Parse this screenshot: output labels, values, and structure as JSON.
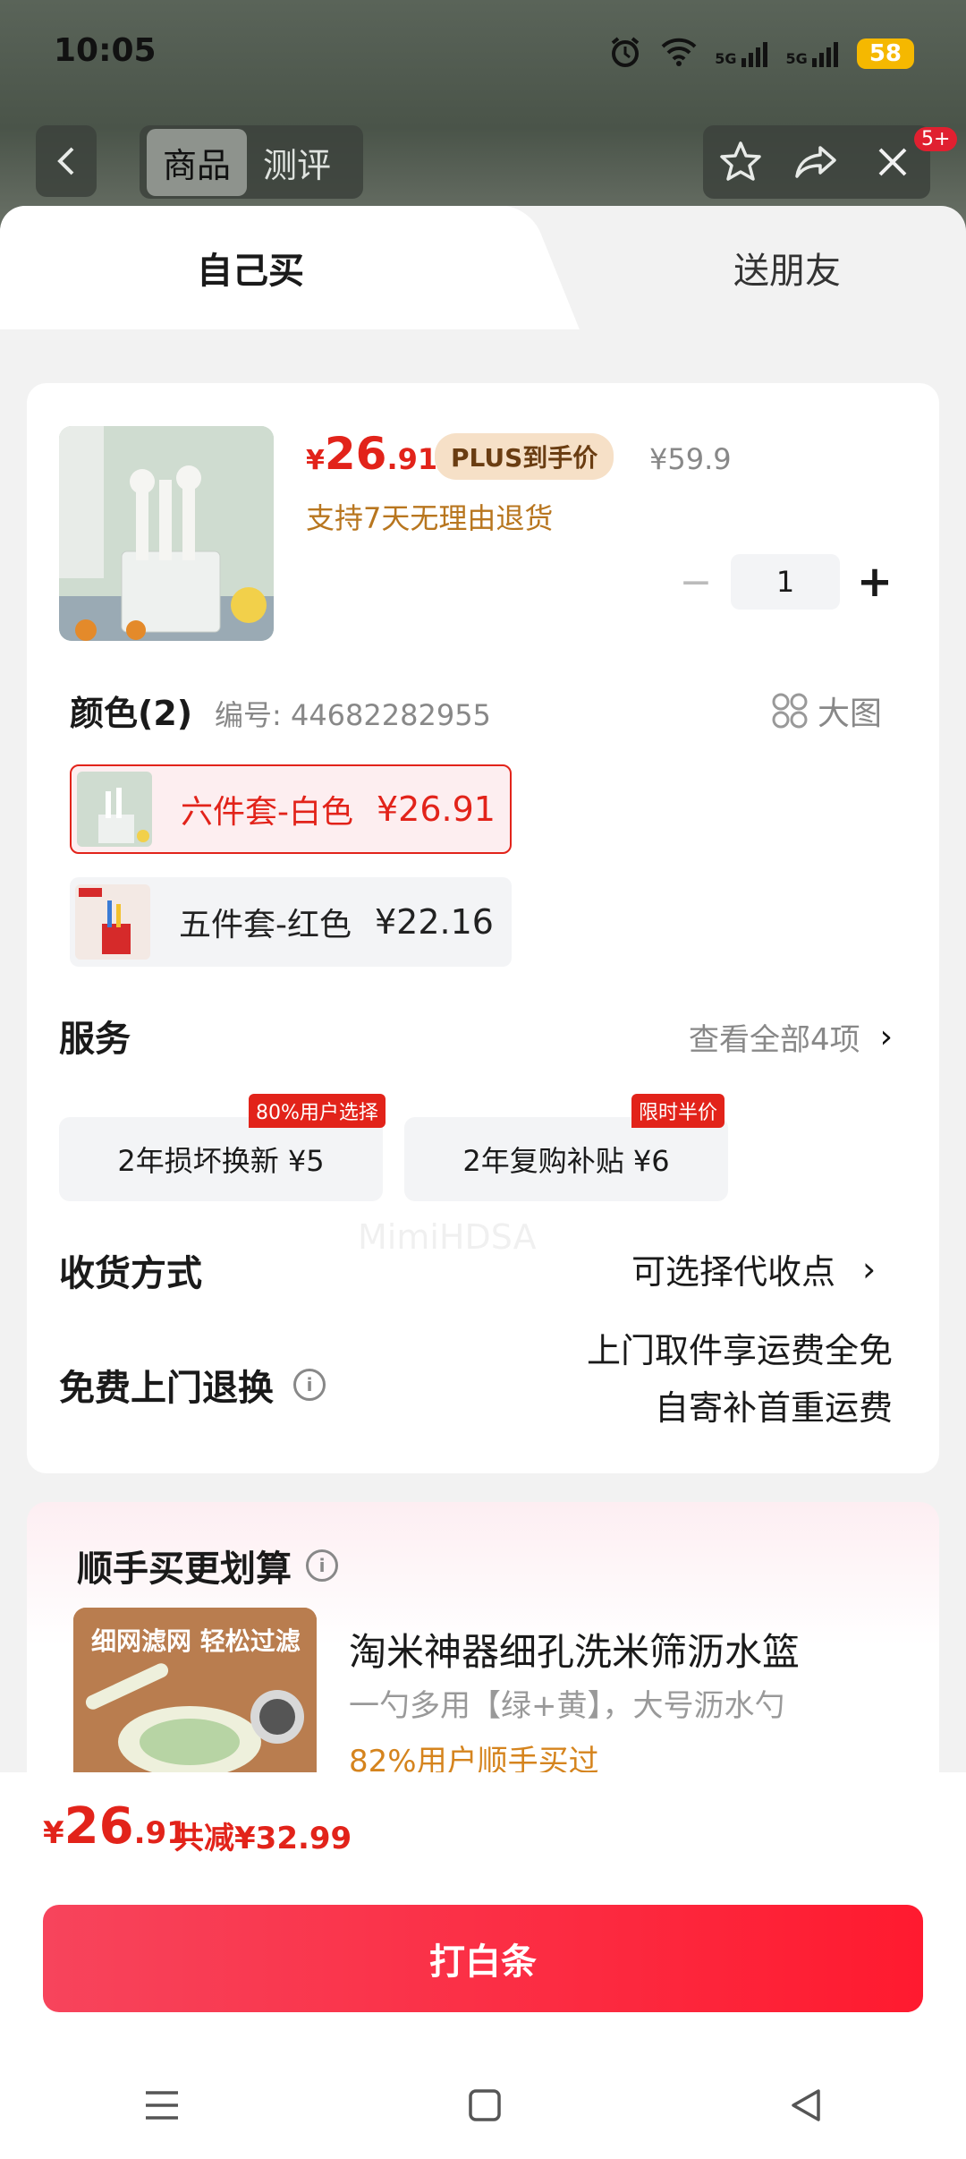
{
  "status": {
    "time": "10:05",
    "battery": "58",
    "net1": "5G",
    "net2": "5G"
  },
  "header": {
    "tabs": [
      "商品",
      "测评"
    ],
    "badge": "5+"
  },
  "sheet": {
    "tabs": {
      "self": "自己买",
      "gift": "送朋友"
    }
  },
  "product": {
    "price_symbol": "¥",
    "price_int": "26",
    "price_dec": ".91",
    "plus_label": "PLUS到手价",
    "orig_price": "¥59.9",
    "returns": "支持7天无理由退货",
    "quantity": "1",
    "minus": "−",
    "plus": "+"
  },
  "colors": {
    "heading": "颜色(2)",
    "sku": "编号: 44682282955",
    "big_view": "大图",
    "options": [
      {
        "label": "六件套-白色",
        "price": "¥26.91",
        "selected": true
      },
      {
        "label": "五件套-红色",
        "price": "¥22.16",
        "selected": false
      }
    ]
  },
  "services": {
    "heading": "服务",
    "view_all": "查看全部4项",
    "items": [
      {
        "label": "2年损坏换新  ¥5",
        "tag": "80%用户选择"
      },
      {
        "label": "2年复购补贴  ¥6",
        "tag": "限时半价"
      }
    ]
  },
  "shipping": {
    "heading": "收货方式",
    "value": "可选择代收点"
  },
  "free_return": {
    "heading": "免费上门退换",
    "line1": "上门取件享运费全免",
    "line2": "自寄补首重运费"
  },
  "deal": {
    "heading": "顺手买更划算",
    "image_caption": "细网滤网 轻松过滤",
    "title": "淘米神器细孔洗米筛沥水篮",
    "subtitle": "一勺多用【绿+黄】，大号沥水勺",
    "percent": "82%用户顺手买过"
  },
  "footer": {
    "price_symbol": "¥",
    "price_int": "26",
    "price_dec": ".91",
    "savings": "共减¥32.99",
    "buy_label": "打白条"
  },
  "watermark": "MimiHDSA",
  "colors_theme": {
    "accent": "#e2231a",
    "gold": "#b8761f",
    "plus_bg": "#f6e0c7"
  }
}
